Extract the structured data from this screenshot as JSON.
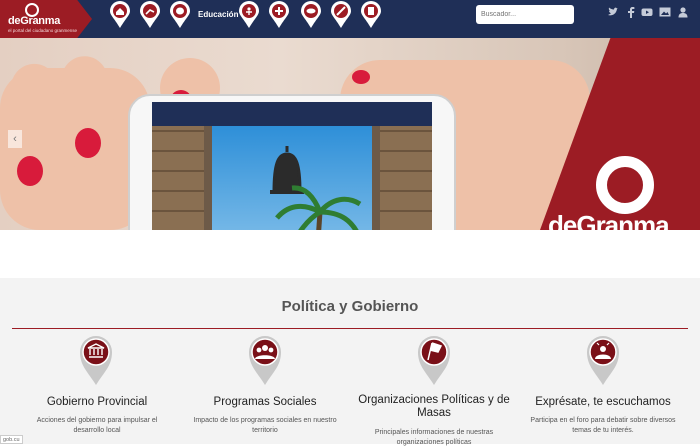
{
  "brand": {
    "name": "deGranma",
    "tagline": "el portal del ciudadano granmense"
  },
  "nav": {
    "items": [
      {
        "icon": "home-icon"
      },
      {
        "icon": "running-icon"
      },
      {
        "icon": "theater-icon"
      },
      {
        "icon": "education-label",
        "label": "Educación"
      },
      {
        "icon": "sports-icon"
      },
      {
        "icon": "health-icon"
      },
      {
        "icon": "weather-icon"
      },
      {
        "icon": "tools-icon"
      },
      {
        "icon": "document-icon"
      }
    ]
  },
  "search": {
    "placeholder": "Buscador..."
  },
  "social": [
    "twitter-icon",
    "facebook-icon",
    "youtube-icon",
    "photos-icon",
    "user-icon"
  ],
  "hero": {
    "watermark": "deGranma"
  },
  "section": {
    "title": "Política y Gobierno",
    "cards": [
      {
        "icon": "government-building-icon",
        "title": "Gobierno Provincial",
        "text": "Acciones del gobierno para impulsar el desarrollo local"
      },
      {
        "icon": "people-group-icon",
        "title": "Programas Sociales",
        "text": "Impacto de los programas sociales en nuestro territorio"
      },
      {
        "icon": "flag-icon",
        "title": "Organizaciones Políticas y de Masas",
        "text": "Principales informaciones de nuestras organizaciones políticas"
      },
      {
        "icon": "speaker-icon",
        "title": "Exprésate, te escuchamos",
        "text": "Participa en el foro para debatir sobre diversos temas de tu interés."
      }
    ]
  },
  "status_text": "gob.cu",
  "colors": {
    "navy": "#1f2f57",
    "brand_red": "#9c1c24"
  }
}
